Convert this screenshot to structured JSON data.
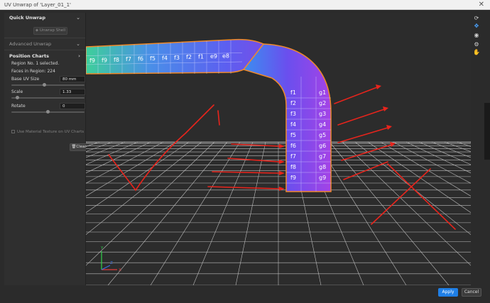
{
  "window": {
    "title": "UV Unwrap of 'Layer_01_1'",
    "close_glyph": "✕"
  },
  "quick_unwrap": {
    "title": "Quick Unwrap",
    "button_label": "Unwrap Shell",
    "button_icon": "shell-icon"
  },
  "advanced_unwrap": {
    "title": "Advanced Unwrap"
  },
  "position_charts": {
    "title": "Position Charts",
    "region_selected": "Region No. 1 selected.",
    "faces": "Faces in Region: 224",
    "base_uv_label": "Base UV Size",
    "base_uv_value": "80 mm",
    "base_uv_level": 0.45,
    "scale_label": "Scale",
    "scale_value": "1.33",
    "scale_level": 0.08,
    "rotate_label": "Rotate",
    "rotate_value": "0",
    "rotate_level": 0.5,
    "checkbox_label": "Use Material Texture on UV Charts",
    "clear_label": "Clear"
  },
  "chevrons": {
    "down": "⌄",
    "right": "›"
  },
  "tools": [
    "refresh-icon",
    "uv-charts-icon",
    "eye-icon",
    "settings-icon",
    "pan-hand-icon"
  ],
  "axes": {
    "x": "X",
    "y": "Y",
    "z": "Z"
  },
  "tile_labels": {
    "horizontal": [
      "f9",
      "f9",
      "f8",
      "f7",
      "f6",
      "f5",
      "f4",
      "f3",
      "f2",
      "f1",
      "e9",
      "e8"
    ],
    "vertical": [
      "f1",
      "g1",
      "f2",
      "g2",
      "f3",
      "g3",
      "f4",
      "g4",
      "f5",
      "g5",
      "f6",
      "g6",
      "f7",
      "g7",
      "f8",
      "g8",
      "f9",
      "g9"
    ]
  },
  "footer": {
    "apply_label": "Apply",
    "cancel_label": "Cancel"
  },
  "colors": {
    "accent": "#1f7fe6",
    "annotation": "#e8241c",
    "mesh_edge": "#f08a2a"
  }
}
